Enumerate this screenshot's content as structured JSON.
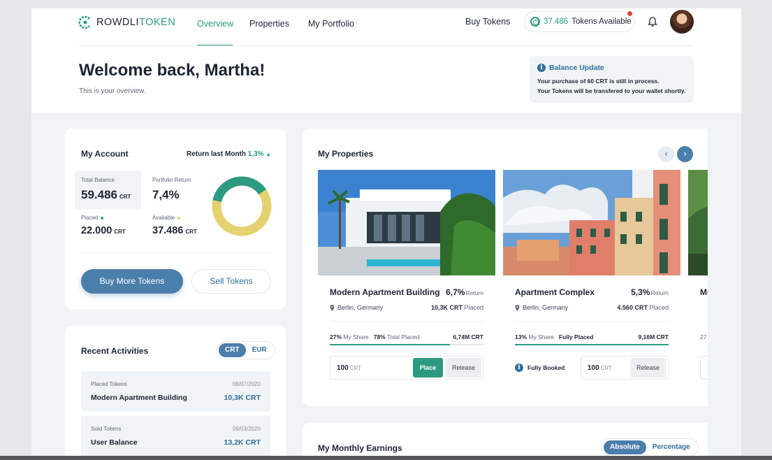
{
  "header": {
    "logo_text_main": "ROWDLI",
    "logo_text_accent": "TOKEN",
    "nav": [
      {
        "label": "Overview",
        "active": true
      },
      {
        "label": "Properties",
        "active": false
      },
      {
        "label": "My Portfolio",
        "active": false
      }
    ],
    "buy_link": "Buy Tokens",
    "tokens_value": "37.486",
    "tokens_label": "Tokens Available",
    "icons": [
      "logo-icon",
      "coin-icon",
      "bell-icon",
      "avatar"
    ]
  },
  "welcome": {
    "title": "Welcome back, Martha!",
    "subtitle": "This is your overview."
  },
  "balance_update": {
    "title": "Balance Update",
    "line1": "Your purchase of 60 CRT is still in process.",
    "line2": "Your Tokens will be transfered to your wallet shortly."
  },
  "account": {
    "title": "My Account",
    "return_label": "Return last Month",
    "return_value": "1,3%",
    "return_arrow": "▲",
    "total_balance_label": "Total Balance",
    "total_balance_value": "59.486",
    "portfolio_return_label": "Portfolio Return",
    "portfolio_return_value": "7,4%",
    "placed_label": "Placed",
    "placed_value": "22.000",
    "available_label": "Available",
    "available_value": "37.486",
    "unit": "CRT",
    "donut_placed_fraction": 0.37,
    "buy_more": "Buy More Tokens",
    "sell": "Sell Tokens",
    "colors": {
      "placed": "#2c9a80",
      "available": "#e3d26f"
    }
  },
  "activities": {
    "title": "Recent Activities",
    "toggle": [
      "CRT",
      "EUR"
    ],
    "items": [
      {
        "type": "Placed Tokens",
        "date": "06/07/2020",
        "name": "Modern Apartment  Building",
        "amount": "10,3K CRT"
      },
      {
        "type": "Sold Tokens",
        "date": "06/03/2020",
        "name": "User Balance",
        "amount": "13,2K CRT"
      }
    ]
  },
  "properties": {
    "title": "My Properties",
    "prev": "‹",
    "next": "›",
    "items": [
      {
        "name": "Modern Apartment Building",
        "return": "6,7%",
        "return_label": "Return",
        "location": "Berlin, Germany",
        "placed_value": "10,3K CRT",
        "placed_label": "Placed",
        "my_share_pct": "27%",
        "my_share_label": "My Share",
        "total_placed_pct": "78%",
        "total_placed_label": "Total Placed",
        "total": "6,74M CRT",
        "progress": 0.78,
        "order_amount": "100",
        "order_unit": "CRT",
        "place": "Place",
        "release": "Release"
      },
      {
        "name": "Apartment Complex",
        "return": "5,3%",
        "return_label": "Return",
        "location": "Berlin, Germany",
        "placed_value": "4.560  CRT",
        "placed_label": "Placed",
        "my_share_pct": "13%",
        "my_share_label": "My Share",
        "fully_placed": "Fully Placed",
        "total": "9,16M CRT",
        "progress": 1.0,
        "booked": "Fully Booked",
        "order_amount": "100",
        "order_unit": "CRT",
        "release": "Release"
      },
      {
        "name": "Mo",
        "share_pct": "27"
      }
    ]
  },
  "earnings": {
    "title": "My Monthly Earnings",
    "toggle": [
      "Absolute",
      "Percentage"
    ]
  }
}
